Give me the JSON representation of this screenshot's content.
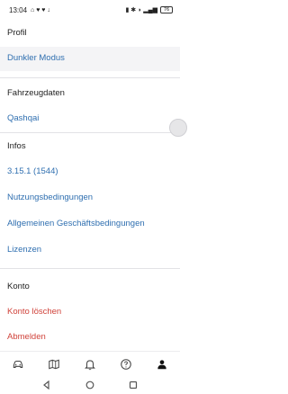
{
  "status_bar": {
    "time": "13:04",
    "battery": "76"
  },
  "profile": {
    "header": "Profil",
    "dark_mode": "Dunkler Modus"
  },
  "vehicle": {
    "header": "Fahrzeugdaten",
    "model": "Qashqai"
  },
  "info": {
    "header": "Infos",
    "version": "3.15.1 (1544)",
    "terms_of_use": "Nutzungsbedingungen",
    "general_terms": "Allgemeinen Geschäftsbedingungen",
    "licenses": "Lizenzen"
  },
  "account": {
    "header": "Konto",
    "delete_account": "Konto löschen",
    "logout": "Abmelden"
  },
  "bottom_nav": {
    "icons": [
      "car-icon",
      "map-icon",
      "bell-icon",
      "help-icon",
      "person-icon"
    ],
    "active_index": 4
  },
  "colors": {
    "link": "#2f6fb0",
    "danger": "#d0433b",
    "section_bg": "#f4f4f6"
  }
}
